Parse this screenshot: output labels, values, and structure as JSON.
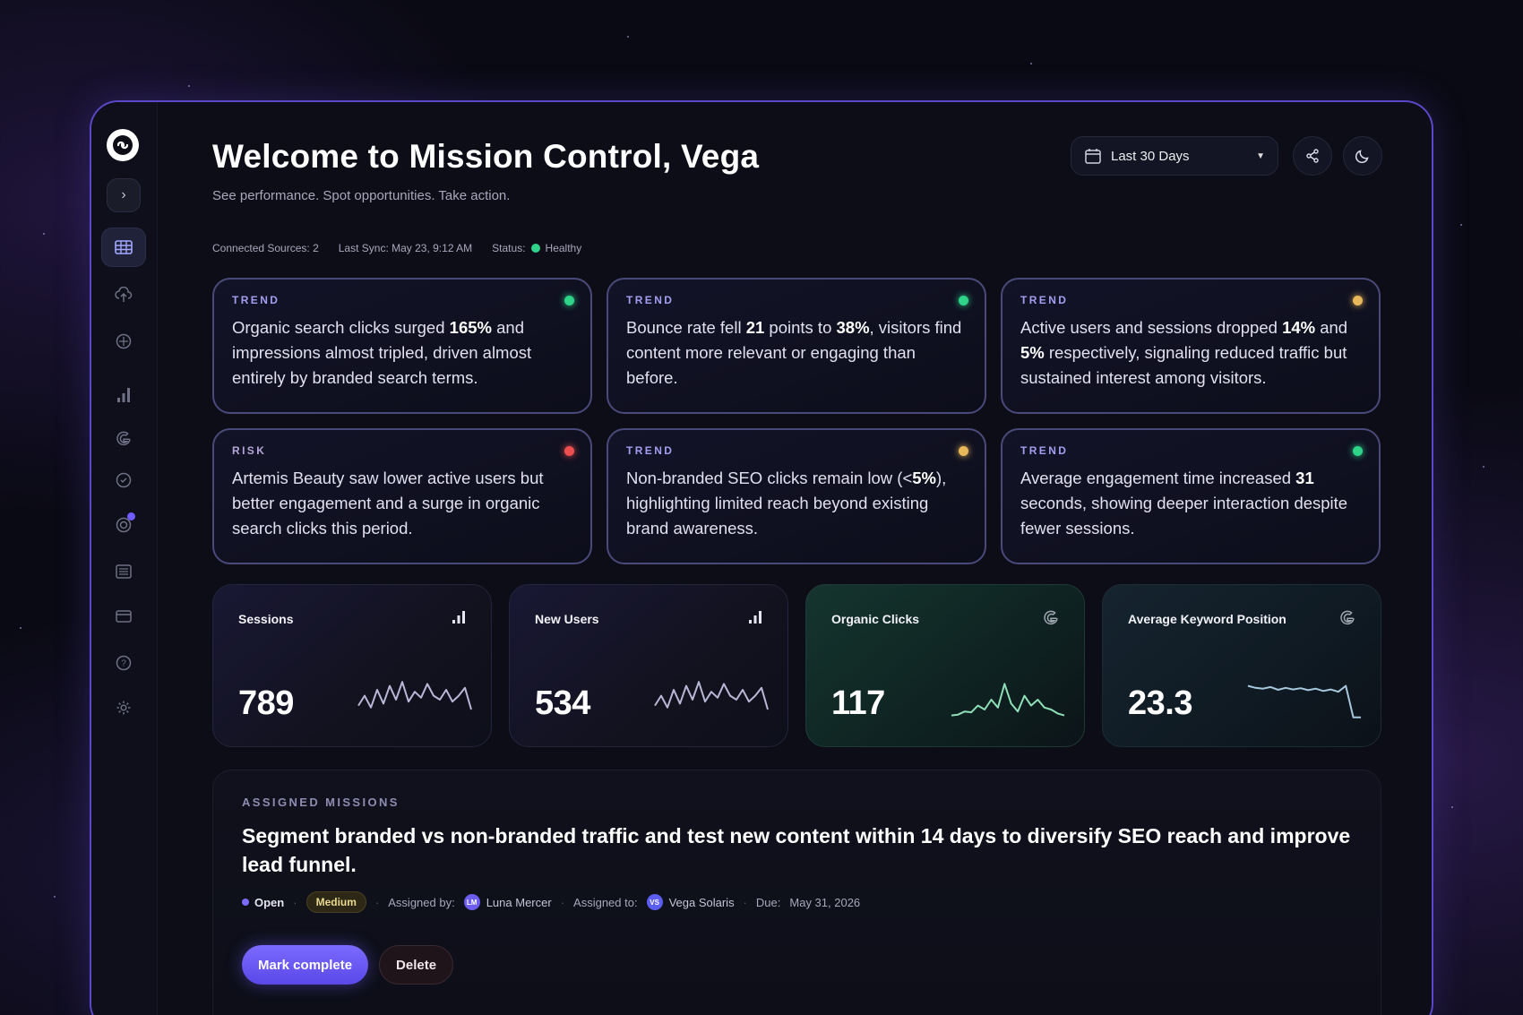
{
  "header": {
    "title": "Welcome to Mission Control, Vega",
    "subtitle": "See performance. Spot opportunities. Take action.",
    "meta": {
      "connected_sources": "Connected Sources: 2",
      "last_sync": "Last Sync: May 23, 9:12 AM",
      "status_label": "Status:",
      "status_value": "Healthy"
    },
    "date_range": "Last 30 Days"
  },
  "sidebar": {
    "items": [
      {
        "name": "dashboard-icon",
        "active": true
      },
      {
        "name": "cloud-upload-icon",
        "active": false
      },
      {
        "name": "compass-icon",
        "active": false
      },
      {
        "name": "bar-chart-icon",
        "active": false
      },
      {
        "name": "google-icon",
        "active": false
      },
      {
        "name": "clock-check-icon",
        "active": false
      },
      {
        "name": "target-icon",
        "active": false,
        "notification": true
      },
      {
        "name": "list-icon",
        "active": false
      },
      {
        "name": "card-icon",
        "active": false
      },
      {
        "name": "help-icon",
        "active": false
      },
      {
        "name": "settings-icon",
        "active": false
      }
    ]
  },
  "insights": [
    {
      "tag": "TREND",
      "status_color": "#2fd38a",
      "parts": [
        "Organic search clicks surged ",
        "165%",
        " and impressions almost tripled, driven almost entirely by branded search terms."
      ]
    },
    {
      "tag": "TREND",
      "status_color": "#2fd38a",
      "parts": [
        "Bounce rate fell ",
        "21",
        " points to ",
        "38%",
        ", visitors find content more relevant or engaging than before."
      ]
    },
    {
      "tag": "TREND",
      "status_color": "#e8b95a",
      "parts": [
        "Active users and sessions dropped ",
        "14%",
        " and ",
        "5%",
        " respectively, signaling reduced traffic but sustained interest among visitors."
      ]
    },
    {
      "tag": "RISK",
      "status_color": "#ef4f4f",
      "parts": [
        "Artemis Beauty saw lower active users but better engagement and a surge in organic search clicks this period."
      ]
    },
    {
      "tag": "TREND",
      "status_color": "#e8b95a",
      "parts": [
        "Non-branded SEO clicks remain low (<",
        "5%",
        "), highlighting limited reach beyond existing brand awareness."
      ]
    },
    {
      "tag": "TREND",
      "status_color": "#2fd38a",
      "parts": [
        "Average engagement time increased ",
        "31",
        " seconds, showing deeper interaction despite fewer sessions."
      ]
    }
  ],
  "metrics": [
    {
      "label": "Sessions",
      "value": "789",
      "icon": "bar-chart-icon",
      "spark": [
        0.35,
        0.6,
        0.3,
        0.75,
        0.4,
        0.85,
        0.5,
        0.95,
        0.45,
        0.7,
        0.55,
        0.9,
        0.6,
        0.5,
        0.75,
        0.45,
        0.6,
        0.8,
        0.25
      ]
    },
    {
      "label": "New Users",
      "value": "534",
      "icon": "bar-chart-icon",
      "spark": [
        0.35,
        0.6,
        0.3,
        0.75,
        0.4,
        0.85,
        0.5,
        0.95,
        0.45,
        0.7,
        0.55,
        0.9,
        0.6,
        0.5,
        0.75,
        0.45,
        0.6,
        0.8,
        0.25
      ]
    },
    {
      "label": "Organic Clicks",
      "value": "117",
      "icon": "google-icon",
      "spark": [
        0.1,
        0.12,
        0.2,
        0.18,
        0.35,
        0.25,
        0.5,
        0.3,
        0.9,
        0.4,
        0.2,
        0.6,
        0.35,
        0.5,
        0.3,
        0.25,
        0.15,
        0.1
      ]
    },
    {
      "label": "Average Keyword Position",
      "value": "23.3",
      "icon": "google-icon",
      "spark": [
        0.85,
        0.8,
        0.78,
        0.82,
        0.75,
        0.8,
        0.76,
        0.79,
        0.74,
        0.78,
        0.72,
        0.76,
        0.7,
        0.85,
        0.05,
        0.05
      ]
    }
  ],
  "missions": {
    "tag": "ASSIGNED MISSIONS",
    "title": "Segment branded vs non-branded traffic and test new content within 14 days to diversify SEO reach and improve lead funnel.",
    "status": "Open",
    "priority": "Medium",
    "assigned_by_label": "Assigned by:",
    "assigned_by_initials": "LM",
    "assigned_by": "Luna Mercer",
    "assigned_to_label": "Assigned to:",
    "assigned_to_initials": "VS",
    "assigned_to": "Vega Solaris",
    "due_label": "Due:",
    "due": "May 31, 2026",
    "complete_label": "Mark complete",
    "delete_label": "Delete"
  }
}
